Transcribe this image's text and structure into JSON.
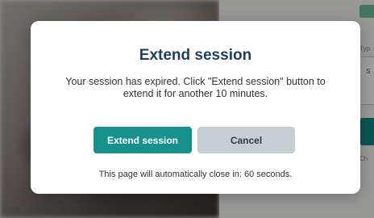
{
  "background": {
    "side_label_top": "Typ",
    "side_field_text": "S",
    "side_label_bottom": "Ch"
  },
  "dialog": {
    "title": "Extend session",
    "message": "Your session has expired. Click \"Extend session\" button to extend it for another 10 minutes.",
    "extend_label": "Extend session",
    "cancel_label": "Cancel",
    "countdown_text": "This page will automatically close in: 60 seconds."
  },
  "colors": {
    "title": "#1f3f5f",
    "primary_button": "#17918b",
    "secondary_button": "#c4ced4",
    "overlay": "rgba(0,0,0,0.38)"
  }
}
